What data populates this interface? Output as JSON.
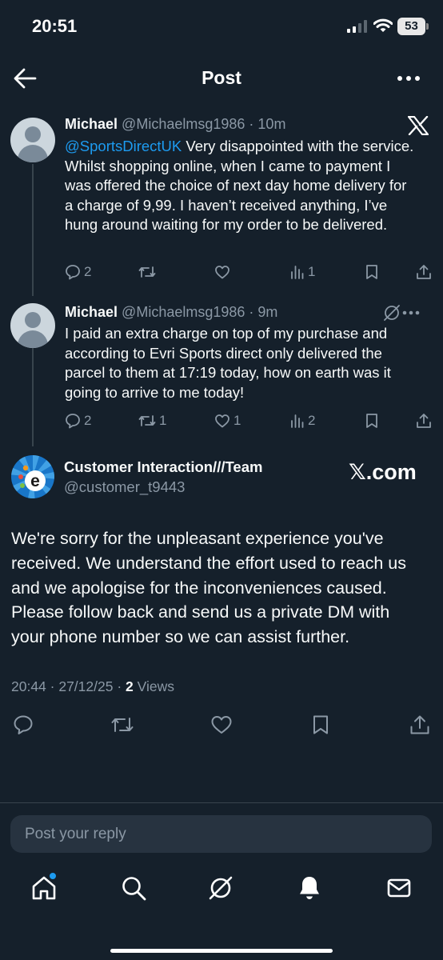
{
  "status_bar": {
    "time": "20:51",
    "battery": "53"
  },
  "header": {
    "title": "Post"
  },
  "thread": [
    {
      "name": "Michael",
      "handle": "@Michaelmsg1986",
      "time": "· 10m",
      "mention": "@SportsDirectUK",
      "text": " Very disappointed with the service. Whilst shopping online, when I came to payment I was offered the choice of next day home delivery for a charge of 9,99. I haven’t received anything, I’ve hung around waiting for my order to be delivered.",
      "replies": "2",
      "reposts": "",
      "likes": "",
      "views": "1"
    },
    {
      "name": "Michael",
      "handle": "@Michaelmsg1986",
      "time": "· 9m",
      "text": "I paid an extra charge on top of my purchase and according to Evri Sports direct only delivered the parcel to them at 17:19 today, how on earth was it going to arrive to me today!",
      "replies": "2",
      "reposts": "1",
      "likes": "1",
      "views": "2"
    }
  ],
  "main_post": {
    "name": "Customer Interaction///Team",
    "handle": "@customer_t9443",
    "watermark": "𝕏.com",
    "text": "We're sorry for the unpleasant experience you've received. We understand the effort used to reach us and we apologise for the inconveniences caused. Please follow back and send us a private DM with your phone number so we can assist further.",
    "timestamp": "20:44 · 27/12/25 · ",
    "views_count": "2",
    "views_label": " Views"
  },
  "reply": {
    "placeholder": "Post your reply"
  },
  "icons": {
    "back": "back-arrow-icon",
    "more": "more-icon",
    "x_logo": "x-logo-icon",
    "grok": "grok-icon",
    "reply": "reply-icon",
    "repost": "repost-icon",
    "like": "like-icon",
    "views": "views-icon",
    "bookmark": "bookmark-icon",
    "share": "share-icon",
    "home": "home-icon",
    "search": "search-icon",
    "notifications": "bell-icon",
    "messages": "mail-icon"
  },
  "colors": {
    "background": "#15202b",
    "accent": "#1d9bf0",
    "muted": "#8b98a5"
  }
}
